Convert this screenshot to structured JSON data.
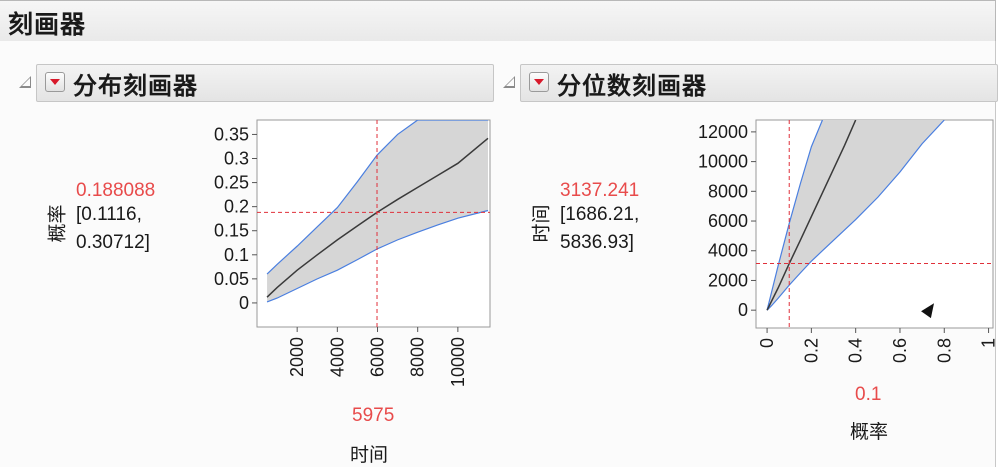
{
  "app": {
    "title": "刻画器"
  },
  "panels": [
    {
      "title": "分布刻画器",
      "ylabel_text": "概率",
      "xlabel_text": "时间",
      "y_current": "0.188088",
      "ci_line1": "[0.1116,",
      "ci_line2": "0.30712]",
      "x_current": "5975"
    },
    {
      "title": "分位数刻画器",
      "ylabel_text": "时间",
      "xlabel_text": "概率",
      "y_current": "3137.241",
      "ci_line1": "[1686.21,",
      "ci_line2": "5836.93]",
      "x_current": "0.1"
    }
  ],
  "colors": {
    "curve": "#3a3a3a",
    "band": "#d6d6d6",
    "band_edge": "#4a7fe0",
    "crosshair": "#e0303a"
  },
  "chart_data": [
    {
      "type": "line",
      "title": "分布刻画器",
      "xlabel": "时间",
      "ylabel": "概率",
      "xlim": [
        0,
        11600
      ],
      "ylim": [
        -0.05,
        0.38
      ],
      "xticks": [
        2000,
        4000,
        6000,
        8000,
        10000
      ],
      "yticks": [
        0,
        0.05,
        0.1,
        0.15,
        0.2,
        0.25,
        0.3,
        0.35
      ],
      "grid": false,
      "crosshair": {
        "x": 5975,
        "y": 0.188088
      },
      "x": [
        500,
        1000,
        2000,
        3000,
        4000,
        5000,
        5975,
        7000,
        8000,
        9000,
        10000,
        11500
      ],
      "series": [
        {
          "role": "estimate",
          "values": [
            0.012,
            0.032,
            0.068,
            0.1,
            0.131,
            0.16,
            0.188,
            0.215,
            0.24,
            0.265,
            0.29,
            0.342
          ]
        },
        {
          "role": "lower",
          "values": [
            0.002,
            0.01,
            0.03,
            0.05,
            0.068,
            0.09,
            0.112,
            0.131,
            0.147,
            0.162,
            0.176,
            0.192
          ]
        },
        {
          "role": "upper",
          "values": [
            0.06,
            0.08,
            0.118,
            0.158,
            0.198,
            0.252,
            0.307,
            0.35,
            0.38,
            0.38,
            0.38,
            0.38
          ]
        }
      ]
    },
    {
      "type": "line",
      "title": "分位数刻画器",
      "xlabel": "概率",
      "ylabel": "时间",
      "xlim": [
        -0.05,
        1.02
      ],
      "ylim": [
        -1200,
        12800
      ],
      "xticks": [
        0,
        0.2,
        0.4,
        0.6,
        0.8,
        1
      ],
      "yticks": [
        0,
        2000,
        4000,
        6000,
        8000,
        10000,
        12000
      ],
      "grid": false,
      "crosshair": {
        "x": 0.1,
        "y": 3137.241
      },
      "x": [
        0,
        0.02,
        0.05,
        0.1,
        0.15,
        0.2,
        0.25,
        0.3,
        0.35,
        0.4,
        0.5,
        0.6,
        0.7,
        0.8
      ],
      "series": [
        {
          "role": "estimate",
          "values": [
            0,
            600,
            1500,
            3137,
            4700,
            6300,
            7900,
            9500,
            11100,
            12800,
            null,
            null,
            null,
            null
          ]
        },
        {
          "role": "lower",
          "values": [
            0,
            300,
            800,
            1686,
            2500,
            3300,
            4000,
            4700,
            5400,
            6100,
            7600,
            9300,
            11200,
            12800
          ]
        },
        {
          "role": "upper",
          "values": [
            0,
            1200,
            3000,
            5837,
            8500,
            11000,
            12800,
            null,
            null,
            null,
            null,
            null,
            null,
            null
          ]
        }
      ]
    }
  ]
}
